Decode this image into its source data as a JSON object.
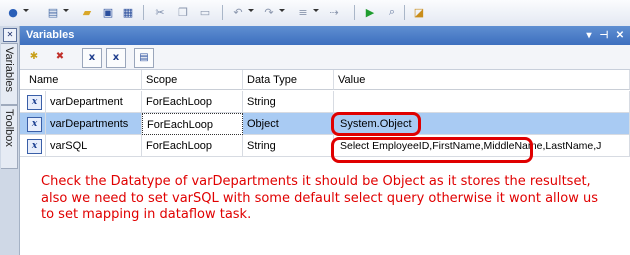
{
  "panel": {
    "title": "Variables",
    "controls": [
      "▾",
      "⊣",
      "✕"
    ]
  },
  "dock_tabs": [
    "Variables",
    "Toolbox"
  ],
  "grid": {
    "columns": [
      "Name",
      "Scope",
      "Data Type",
      "Value"
    ],
    "rows": [
      {
        "name": "varDepartment",
        "scope": "ForEachLoop",
        "type": "String",
        "value": ""
      },
      {
        "name": "varDepartments",
        "scope": "ForEachLoop",
        "type": "Object",
        "value": "System.Object"
      },
      {
        "name": "varSQL",
        "scope": "ForEachLoop",
        "type": "String",
        "value": "Select EmployeeID,FirstName,MiddleName,LastName,J"
      }
    ]
  },
  "annotation": "Check the Datatype of varDepartments it should be Object as it stores the resultset, also we need to set varSQL with some default select query otherwise it wont allow us to set mapping in dataflow task.",
  "colors": {
    "annotation": "#e00000",
    "selected_row": "#a9cbf3",
    "title_bar": "#3d6fbf"
  }
}
